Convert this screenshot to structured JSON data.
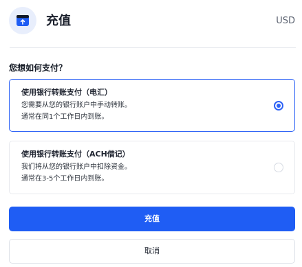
{
  "header": {
    "title": "充值",
    "currency": "USD",
    "icon": "deposit-icon"
  },
  "question": "您想如何支付？",
  "options": [
    {
      "title": "使用银行转账支付（电汇）",
      "line1": "您需要从您的银行账户中手动转账。",
      "line2": "通常在同1个工作日内到账。",
      "selected": true
    },
    {
      "title": "使用银行转账支付（ACH借记）",
      "line1": "我们将从您的银行账户中扣除资金。",
      "line2": "通常在3-5个工作日内到账。",
      "selected": false
    }
  ],
  "buttons": {
    "primary": "充值",
    "secondary": "取消"
  },
  "colors": {
    "accent": "#2d62f6",
    "primary_button": "#1f5df4",
    "icon_bg": "#e8eefc",
    "icon_fg": "#1f5df4",
    "icon_dark": "#101828"
  }
}
